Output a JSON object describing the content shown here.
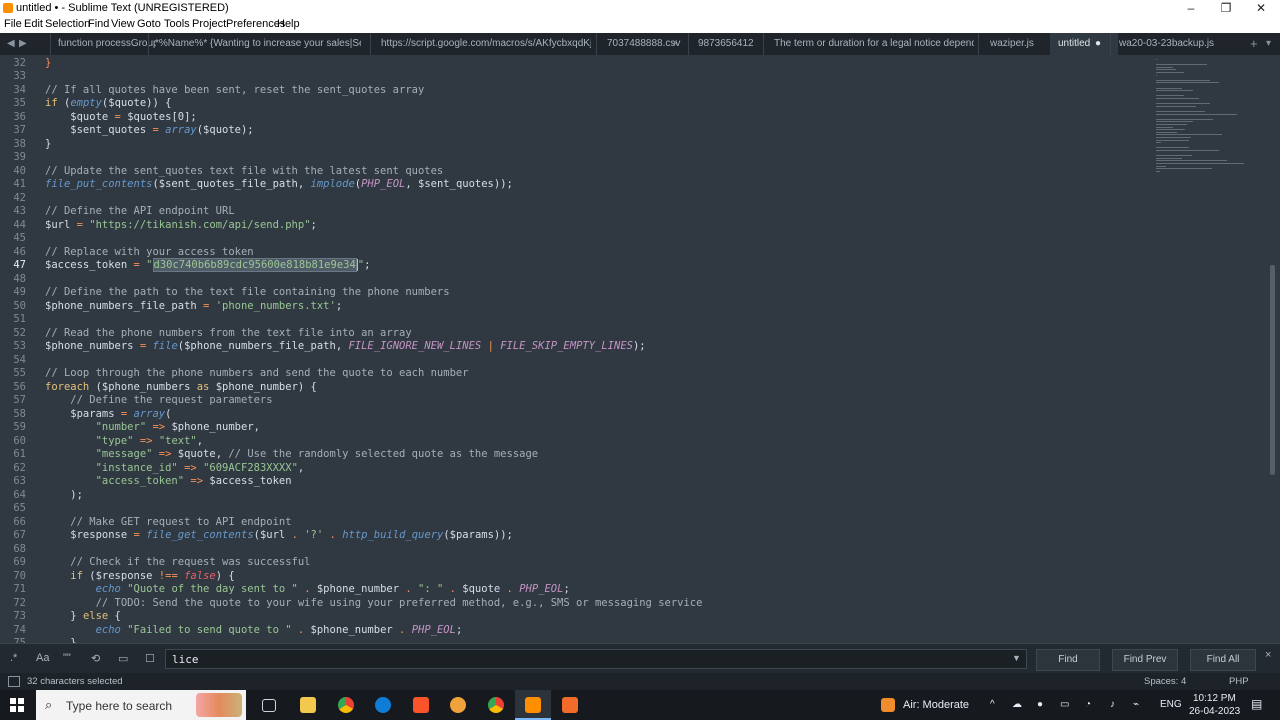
{
  "window": {
    "title": "untitled • - Sublime Text (UNREGISTERED)",
    "controls": [
      "–",
      "❐",
      "✕"
    ]
  },
  "menu": [
    "File",
    "Edit",
    "Selection",
    "Find",
    "View",
    "Goto",
    "Tools",
    "Project",
    "Preferences",
    "Help"
  ],
  "tabs": [
    "function processGroup(e",
    "*%Name%* {Wanting to increase your sales|Seeking t",
    "https://script.google.com/macros/s/AKfycbxqdKjZ-vU",
    "7037488888.csv",
    "9873656412",
    "The term or duration for a legal notice depends on",
    "waziper.js",
    "untitled",
    "wa20-03-23backup.js"
  ],
  "editor": {
    "first_line": 32,
    "current_line": 47,
    "selected_text": "d30c740b6b89cdc95600e818b81e9e34",
    "lines": [
      [
        [
          "op",
          "}"
        ]
      ],
      [],
      [
        [
          "cm",
          "// If all quotes have been sent, reset the sent_quotes array"
        ]
      ],
      [
        [
          "kw",
          "if"
        ],
        [
          "var",
          " ("
        ],
        [
          "fn",
          "empty"
        ],
        [
          "var",
          "($quote)) {"
        ]
      ],
      [
        [
          "var",
          "    $quote "
        ],
        [
          "op",
          "="
        ],
        [
          "var",
          " $quotes[0];"
        ]
      ],
      [
        [
          "var",
          "    $sent_quotes "
        ],
        [
          "op",
          "="
        ],
        [
          "var",
          " "
        ],
        [
          "fn",
          "array"
        ],
        [
          "var",
          "($quote);"
        ]
      ],
      [
        [
          "var",
          "}"
        ]
      ],
      [],
      [
        [
          "cm",
          "// Update the sent_quotes text file with the latest sent quotes"
        ]
      ],
      [
        [
          "fn",
          "file_put_contents"
        ],
        [
          "var",
          "($sent_quotes_file_path, "
        ],
        [
          "fn",
          "implode"
        ],
        [
          "var",
          "("
        ],
        [
          "const",
          "PHP_EOL"
        ],
        [
          "var",
          ", $sent_quotes));"
        ]
      ],
      [],
      [
        [
          "cm",
          "// Define the API endpoint URL"
        ]
      ],
      [
        [
          "var",
          "$url "
        ],
        [
          "op",
          "="
        ],
        [
          "var",
          " "
        ],
        [
          "str",
          "\"https://tikanish.com/api/send.php\""
        ],
        [
          "var",
          ";"
        ]
      ],
      [],
      [
        [
          "cm",
          "// Replace with your access token"
        ]
      ],
      [
        [
          "var",
          "$access_token "
        ],
        [
          "op",
          "="
        ],
        [
          "var",
          " "
        ],
        [
          "str",
          "\""
        ],
        [
          "sel",
          "d30c740b6b89cdc95600e818b81e9e34"
        ],
        [
          "caret",
          ""
        ],
        [
          "str",
          "\""
        ],
        [
          "var",
          ";"
        ]
      ],
      [],
      [
        [
          "cm",
          "// Define the path to the text file containing the phone numbers"
        ]
      ],
      [
        [
          "var",
          "$phone_numbers_file_path "
        ],
        [
          "op",
          "="
        ],
        [
          "var",
          " "
        ],
        [
          "str",
          "'phone_numbers.txt'"
        ],
        [
          "var",
          ";"
        ]
      ],
      [],
      [
        [
          "cm",
          "// Read the phone numbers from the text file into an array"
        ]
      ],
      [
        [
          "var",
          "$phone_numbers "
        ],
        [
          "op",
          "="
        ],
        [
          "var",
          " "
        ],
        [
          "fn",
          "file"
        ],
        [
          "var",
          "($phone_numbers_file_path, "
        ],
        [
          "const",
          "FILE_IGNORE_NEW_LINES"
        ],
        [
          "var",
          " "
        ],
        [
          "op",
          "|"
        ],
        [
          "var",
          " "
        ],
        [
          "const",
          "FILE_SKIP_EMPTY_LINES"
        ],
        [
          "var",
          ");"
        ]
      ],
      [],
      [
        [
          "cm",
          "// Loop through the phone numbers and send the quote to each number"
        ]
      ],
      [
        [
          "kw",
          "foreach"
        ],
        [
          "var",
          " ($phone_numbers "
        ],
        [
          "kw",
          "as"
        ],
        [
          "var",
          " $phone_number) {"
        ]
      ],
      [
        [
          "cm",
          "    // Define the request parameters"
        ]
      ],
      [
        [
          "var",
          "    $params "
        ],
        [
          "op",
          "="
        ],
        [
          "var",
          " "
        ],
        [
          "fn",
          "array"
        ],
        [
          "var",
          "("
        ]
      ],
      [
        [
          "str",
          "        \"number\""
        ],
        [
          "var",
          " "
        ],
        [
          "op",
          "=>"
        ],
        [
          "var",
          " $phone_number,"
        ]
      ],
      [
        [
          "str",
          "        \"type\""
        ],
        [
          "var",
          " "
        ],
        [
          "op",
          "=>"
        ],
        [
          "var",
          " "
        ],
        [
          "str",
          "\"text\""
        ],
        [
          "var",
          ","
        ]
      ],
      [
        [
          "str",
          "        \"message\""
        ],
        [
          "var",
          " "
        ],
        [
          "op",
          "=>"
        ],
        [
          "var",
          " $quote, "
        ],
        [
          "cm",
          "// Use the randomly selected quote as the message"
        ]
      ],
      [
        [
          "str",
          "        \"instance_id\""
        ],
        [
          "var",
          " "
        ],
        [
          "op",
          "=>"
        ],
        [
          "var",
          " "
        ],
        [
          "str",
          "\"609ACF283XXXX\""
        ],
        [
          "var",
          ","
        ]
      ],
      [
        [
          "str",
          "        \"access_token\""
        ],
        [
          "var",
          " "
        ],
        [
          "op",
          "=>"
        ],
        [
          "var",
          " $access_token"
        ]
      ],
      [
        [
          "var",
          "    );"
        ]
      ],
      [],
      [
        [
          "cm",
          "    // Make GET request to API endpoint"
        ]
      ],
      [
        [
          "var",
          "    $response "
        ],
        [
          "op",
          "="
        ],
        [
          "var",
          " "
        ],
        [
          "fn",
          "file_get_contents"
        ],
        [
          "var",
          "($url "
        ],
        [
          "op",
          "."
        ],
        [
          "var",
          " "
        ],
        [
          "str",
          "'?'"
        ],
        [
          "var",
          " "
        ],
        [
          "op",
          "."
        ],
        [
          "var",
          " "
        ],
        [
          "fn",
          "http_build_query"
        ],
        [
          "var",
          "($params));"
        ]
      ],
      [],
      [
        [
          "cm",
          "    // Check if the request was successful"
        ]
      ],
      [
        [
          "kw",
          "    if"
        ],
        [
          "var",
          " ($response "
        ],
        [
          "op",
          "!=="
        ],
        [
          "var",
          " "
        ],
        [
          "falsekw",
          "false"
        ],
        [
          "var",
          ") {"
        ]
      ],
      [
        [
          "echo",
          "        echo"
        ],
        [
          "var",
          " "
        ],
        [
          "str",
          "\"Quote of the day sent to \""
        ],
        [
          "var",
          " "
        ],
        [
          "op",
          "."
        ],
        [
          "var",
          " $phone_number "
        ],
        [
          "op",
          "."
        ],
        [
          "var",
          " "
        ],
        [
          "str",
          "\": \""
        ],
        [
          "var",
          " "
        ],
        [
          "op",
          "."
        ],
        [
          "var",
          " $quote "
        ],
        [
          "op",
          "."
        ],
        [
          "var",
          " "
        ],
        [
          "const",
          "PHP_EOL"
        ],
        [
          "var",
          ";"
        ]
      ],
      [
        [
          "cm",
          "        // TODO: Send the quote to your wife using your preferred method, e.g., SMS or messaging service"
        ]
      ],
      [
        [
          "var",
          "    } "
        ],
        [
          "kw",
          "else"
        ],
        [
          "var",
          " {"
        ]
      ],
      [
        [
          "echo",
          "        echo"
        ],
        [
          "var",
          " "
        ],
        [
          "str",
          "\"Failed to send quote to \""
        ],
        [
          "var",
          " "
        ],
        [
          "op",
          "."
        ],
        [
          "var",
          " $phone_number "
        ],
        [
          "op",
          "."
        ],
        [
          "var",
          " "
        ],
        [
          "const",
          "PHP_EOL"
        ],
        [
          "var",
          ";"
        ]
      ],
      [
        [
          "var",
          "    }"
        ]
      ]
    ]
  },
  "find": {
    "regex_label": ".*",
    "case_label": "Aa",
    "word_label": "\"\"",
    "wrap_label": "⟲",
    "selection_label": "▭",
    "highlight_label": "☐",
    "query": "lice",
    "find_label": "Find",
    "find_prev_label": "Find Prev",
    "find_all_label": "Find All",
    "close_label": "×"
  },
  "status": {
    "selection": "32 characters selected",
    "spaces": "Spaces: 4",
    "syntax": "PHP"
  },
  "taskbar": {
    "search_placeholder": "Type here to search",
    "weather": "Air: Moderate",
    "language": "ENG",
    "time": "10:12 PM",
    "date": "26-04-2023"
  }
}
